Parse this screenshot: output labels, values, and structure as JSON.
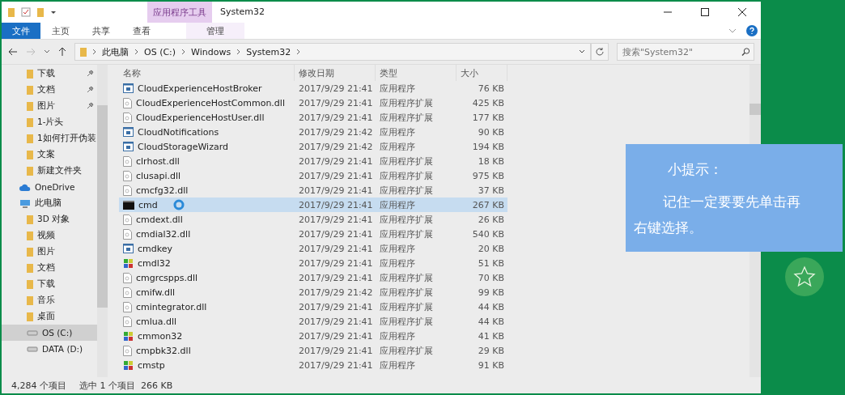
{
  "window": {
    "title": "System32",
    "context_tab": "应用程序工具"
  },
  "ribbon_tabs": [
    {
      "label": "文件",
      "kind": "file"
    },
    {
      "label": "主页",
      "kind": "tab"
    },
    {
      "label": "共享",
      "kind": "tab"
    },
    {
      "label": "查看",
      "kind": "tab"
    },
    {
      "label": "管理",
      "kind": "context"
    }
  ],
  "address": {
    "crumbs": [
      "此电脑",
      "OS (C:)",
      "Windows",
      "System32"
    ]
  },
  "search": {
    "placeholder": "搜索\"System32\""
  },
  "sidebar": {
    "items": [
      {
        "label": "下载",
        "kind": "folder",
        "pinned": true,
        "selected": false
      },
      {
        "label": "文档",
        "kind": "folder",
        "pinned": true,
        "selected": false
      },
      {
        "label": "图片",
        "kind": "folder",
        "pinned": true,
        "selected": false
      },
      {
        "label": "1-片头",
        "kind": "folder",
        "pinned": false,
        "selected": false
      },
      {
        "label": "1如何打开伪装",
        "kind": "folder",
        "pinned": false,
        "selected": false
      },
      {
        "label": "文案",
        "kind": "folder",
        "pinned": false,
        "selected": false
      },
      {
        "label": "新建文件夹",
        "kind": "folder",
        "pinned": false,
        "selected": false
      },
      {
        "label": "OneDrive",
        "kind": "cloud",
        "pinned": false,
        "selected": false
      },
      {
        "label": "此电脑",
        "kind": "pc",
        "pinned": false,
        "selected": false,
        "children": [
          {
            "label": "3D 对象",
            "kind": "folder",
            "selected": false
          },
          {
            "label": "视频",
            "kind": "folder",
            "selected": false
          },
          {
            "label": "图片",
            "kind": "folder",
            "selected": false
          },
          {
            "label": "文档",
            "kind": "folder",
            "selected": false
          },
          {
            "label": "下载",
            "kind": "folder",
            "selected": false
          },
          {
            "label": "音乐",
            "kind": "folder",
            "selected": false
          },
          {
            "label": "桌面",
            "kind": "folder",
            "selected": false
          },
          {
            "label": "OS (C:)",
            "kind": "drive",
            "selected": true
          },
          {
            "label": "DATA (D:)",
            "kind": "drive",
            "selected": false
          }
        ]
      }
    ]
  },
  "table": {
    "columns": [
      "名称",
      "修改日期",
      "类型",
      "大小"
    ],
    "rows": [
      {
        "name": "CloudExperienceHostBroker",
        "date": "2017/9/29 21:41",
        "type": "应用程序",
        "size": "76 KB",
        "kind": "app",
        "selected": false
      },
      {
        "name": "CloudExperienceHostCommon.dll",
        "date": "2017/9/29 21:41",
        "type": "应用程序扩展",
        "size": "425 KB",
        "kind": "dll",
        "selected": false
      },
      {
        "name": "CloudExperienceHostUser.dll",
        "date": "2017/9/29 21:41",
        "type": "应用程序扩展",
        "size": "177 KB",
        "kind": "dll",
        "selected": false
      },
      {
        "name": "CloudNotifications",
        "date": "2017/9/29 21:42",
        "type": "应用程序",
        "size": "90 KB",
        "kind": "app",
        "selected": false
      },
      {
        "name": "CloudStorageWizard",
        "date": "2017/9/29 21:42",
        "type": "应用程序",
        "size": "194 KB",
        "kind": "app",
        "selected": false
      },
      {
        "name": "clrhost.dll",
        "date": "2017/9/29 21:41",
        "type": "应用程序扩展",
        "size": "18 KB",
        "kind": "dll",
        "selected": false
      },
      {
        "name": "clusapi.dll",
        "date": "2017/9/29 21:41",
        "type": "应用程序扩展",
        "size": "975 KB",
        "kind": "dll",
        "selected": false
      },
      {
        "name": "cmcfg32.dll",
        "date": "2017/9/29 21:41",
        "type": "应用程序扩展",
        "size": "37 KB",
        "kind": "dll",
        "selected": false
      },
      {
        "name": "cmd",
        "date": "2017/9/29 21:41",
        "type": "应用程序",
        "size": "267 KB",
        "kind": "console",
        "selected": true
      },
      {
        "name": "cmdext.dll",
        "date": "2017/9/29 21:41",
        "type": "应用程序扩展",
        "size": "26 KB",
        "kind": "dll",
        "selected": false
      },
      {
        "name": "cmdial32.dll",
        "date": "2017/9/29 21:41",
        "type": "应用程序扩展",
        "size": "540 KB",
        "kind": "dll",
        "selected": false
      },
      {
        "name": "cmdkey",
        "date": "2017/9/29 21:41",
        "type": "应用程序",
        "size": "20 KB",
        "kind": "app",
        "selected": false
      },
      {
        "name": "cmdl32",
        "date": "2017/9/29 21:41",
        "type": "应用程序",
        "size": "51 KB",
        "kind": "tool",
        "selected": false
      },
      {
        "name": "cmgrcspps.dll",
        "date": "2017/9/29 21:41",
        "type": "应用程序扩展",
        "size": "70 KB",
        "kind": "dll",
        "selected": false
      },
      {
        "name": "cmifw.dll",
        "date": "2017/9/29 21:42",
        "type": "应用程序扩展",
        "size": "99 KB",
        "kind": "dll",
        "selected": false
      },
      {
        "name": "cmintegrator.dll",
        "date": "2017/9/29 21:41",
        "type": "应用程序扩展",
        "size": "44 KB",
        "kind": "dll",
        "selected": false
      },
      {
        "name": "cmlua.dll",
        "date": "2017/9/29 21:41",
        "type": "应用程序扩展",
        "size": "44 KB",
        "kind": "dll",
        "selected": false
      },
      {
        "name": "cmmon32",
        "date": "2017/9/29 21:41",
        "type": "应用程序",
        "size": "41 KB",
        "kind": "tool",
        "selected": false
      },
      {
        "name": "cmpbk32.dll",
        "date": "2017/9/29 21:41",
        "type": "应用程序扩展",
        "size": "29 KB",
        "kind": "dll",
        "selected": false
      },
      {
        "name": "cmstp",
        "date": "2017/9/29 21:41",
        "type": "应用程序",
        "size": "91 KB",
        "kind": "tool",
        "selected": false
      }
    ]
  },
  "status_bar": {
    "count": "4,284 个项目",
    "selection": "选中 1 个项目  266 KB"
  },
  "tip": {
    "title": "小提示：",
    "body": "记住一定要要先单击再右键选择。"
  }
}
